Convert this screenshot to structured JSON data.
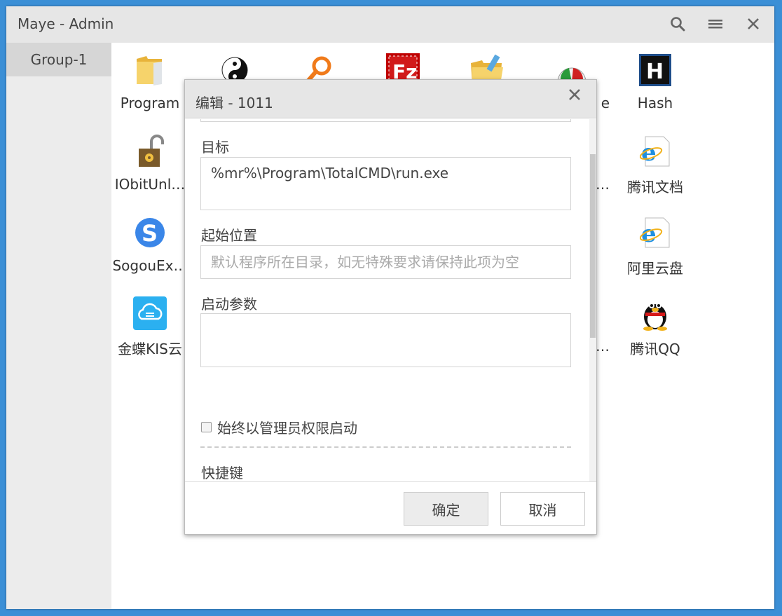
{
  "window": {
    "title": "Maye - Admin"
  },
  "titlebar": {
    "search_icon": "search-icon",
    "menu_icon": "hamburger-menu-icon",
    "close_icon": "close-icon"
  },
  "sidebar": {
    "groups": [
      {
        "label": "Group-1"
      }
    ]
  },
  "tiles": [
    {
      "label": "Program",
      "icon": "folder-icon"
    },
    {
      "label": "",
      "icon": "yinyang-icon"
    },
    {
      "label": "",
      "icon": "magnifier-icon"
    },
    {
      "label": "",
      "icon": "filezilla-icon"
    },
    {
      "label": "",
      "icon": "folder-edit-icon"
    },
    {
      "label": "e",
      "icon": "gauge-icon"
    },
    {
      "label": "Hash",
      "icon": "hash-app-icon"
    },
    {
      "label": "IObitUnl…",
      "icon": "unlocker-icon"
    },
    {
      "label": "…",
      "icon": "hidden-icon"
    },
    {
      "label": "腾讯文档",
      "icon": "ie-icon"
    },
    {
      "label": "SogouEx…",
      "icon": "sogou-explorer-icon"
    },
    {
      "label": "阿里云盘",
      "icon": "ie-icon"
    },
    {
      "label": "金蝶KIS云",
      "icon": "cloud-sync-icon"
    },
    {
      "label": "…",
      "icon": "hidden-icon"
    },
    {
      "label": "腾讯QQ",
      "icon": "qq-penguin-icon"
    }
  ],
  "dialog": {
    "title": "编辑 - 1011",
    "target_label": "目标",
    "target_value": "%mr%\\Program\\TotalCMD\\run.exe",
    "start_dir_label": "起始位置",
    "start_dir_placeholder": "默认程序所在目录，如无特殊要求请保持此项为空",
    "args_label": "启动参数",
    "args_value": "",
    "admin_checkbox_label": "始终以管理员权限启动",
    "admin_checked": false,
    "hotkey_label": "快捷键",
    "hotkey_value": "~",
    "ok_label": "确定",
    "cancel_label": "取消"
  }
}
